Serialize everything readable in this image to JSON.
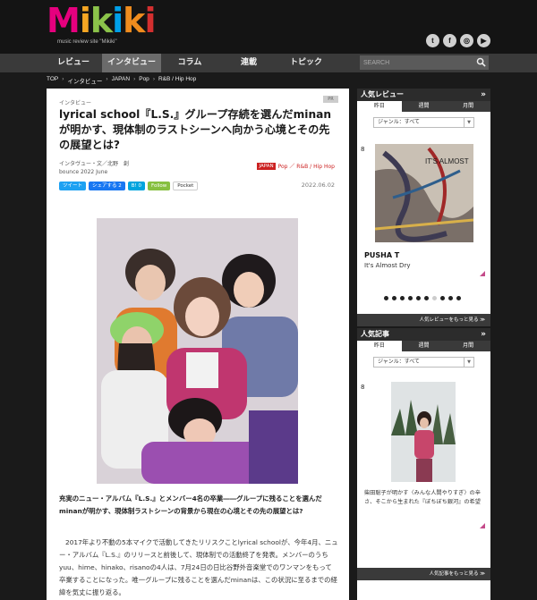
{
  "header": {
    "logo": [
      {
        "char": "M",
        "color": "#e6007e"
      },
      {
        "char": "i",
        "color": "#f5a623"
      },
      {
        "char": "k",
        "color": "#8bc34a"
      },
      {
        "char": "i",
        "color": "#00a0e9"
      },
      {
        "char": "k",
        "color": "#f08c1e"
      },
      {
        "char": "i",
        "color": "#d32f2f"
      }
    ],
    "tagline": "music review site \"Mikiki\"",
    "socials": [
      "twitter-icon",
      "facebook-icon",
      "instagram-icon",
      "youtube-icon"
    ]
  },
  "nav": {
    "items": [
      "レビュー",
      "インタビュー",
      "コラム",
      "連載",
      "トピック"
    ],
    "active_index": 1,
    "search_placeholder": "SEARCH"
  },
  "breadcrumb": [
    "TOP",
    "インタビュー",
    "JAPAN",
    "Pop",
    "R&B / Hip Hop"
  ],
  "article": {
    "category": "インタビュー",
    "pr_tag": "PR",
    "title": "lyrical school『L.S.』グループ存続を選んだminanが明かす、現体制のラストシーンへ向かう心境とその先の展望とは?",
    "byline_1": "インタヴュー・文／北野　創",
    "byline_2": "bounce 2022 June",
    "tag_label": "JAPAN",
    "tag_rest": "Pop ／ R&B / Hip Hop",
    "share": [
      {
        "label": "ツイート",
        "color": "#1da1f2"
      },
      {
        "label": "シェアする 2",
        "color": "#1877f2"
      },
      {
        "label": "B! 0",
        "color": "#00a4de"
      },
      {
        "label": "Follow",
        "color": "#87c040"
      },
      {
        "label": "Pocket",
        "color": "#ffffff"
      }
    ],
    "date": "2022.06.02",
    "lead": "充実のニュー・アルバム『L.S.』とメンバー4名の卒業――グループに残ることを選んだminanが明かす、現体制ラストシーンの背景から現在の心境とその先の展望とは?",
    "body": "2017年より不動の5本マイクで活動してきたリリスクことlyrical schoolが、今年4月、ニュー・アルバム『L.S.』のリリースと前後して、現体制での活動終了を発表。メンバーのうちyuu、hime、hinako、risanoの4人は、7月24日の日比谷野外音楽堂でのワンマンをもって卒業することになった。唯一グループに残ることを選んだminanは、この状況に至るまでの経緯を気丈に振り返る。"
  },
  "sidebar": {
    "reviews": {
      "heading": "人気レビュー",
      "tabs": [
        "昨日",
        "週間",
        "月間"
      ],
      "genre": "ジャンル：すべて",
      "rank": "8",
      "artist": "PUSHA T",
      "album": "It's Almost Dry",
      "cover_text": "IT'S ALMOST",
      "more": "人気レビューをもっと見る ≫",
      "dots": 10,
      "active_dot": 6
    },
    "articles": {
      "heading": "人気記事",
      "tabs": [
        "昨日",
        "週間",
        "月間"
      ],
      "genre": "ジャンル：すべて",
      "rank": "8",
      "title": "柴田聡子が明かす〈みんな人間やりすぎ〉の辛さ、そこから生まれた『ぼちぼち銀河』の希望",
      "more": "人気記事をもっと見る ≫"
    }
  }
}
